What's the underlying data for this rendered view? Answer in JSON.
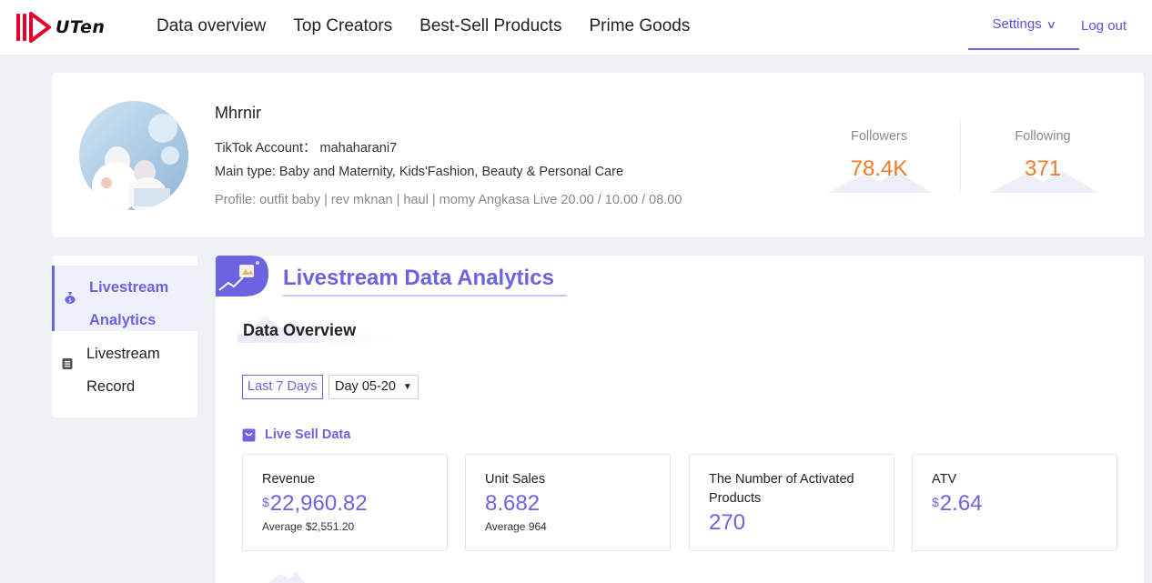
{
  "brand": {
    "name": "UTen",
    "accent": "#6c63e0",
    "highlight": "#f07a28"
  },
  "nav": {
    "items": [
      {
        "label": "Data overview"
      },
      {
        "label": "Top Creators"
      },
      {
        "label": "Best-Sell Products"
      },
      {
        "label": "Prime Goods"
      }
    ],
    "settings_label": "Settings",
    "logout_label": "Log out"
  },
  "profile": {
    "name": "Mhrnir",
    "account": "TikTok Account： mahaharani7",
    "main_type": "Main type:   Baby and Maternity, Kids'Fashion, Beauty & Personal Care",
    "bio": "Profile:  outfit baby | rev mknan | haul | momy Angkasa Live 20.00 / 10.00 / 08.00",
    "followers_label": "Followers",
    "followers_value": "78.4K",
    "following_label": "Following",
    "following_value": "371"
  },
  "sidebar": {
    "items": [
      {
        "label": "Livestream Analytics",
        "icon": "moneybag-icon",
        "active": true
      },
      {
        "label": "Livestream Record",
        "icon": "record-list-icon",
        "active": false
      }
    ]
  },
  "main": {
    "title": "Livestream Data Analytics",
    "overview_title": "Data Overview",
    "range_button": "Last 7 Days",
    "day_select": "Day 05-20",
    "section_title": "Live Sell Data",
    "metrics": [
      {
        "label": "Revenue",
        "currency": "$",
        "value": "22,960.82",
        "avg": "Average $2,551.20"
      },
      {
        "label": "Unit Sales",
        "currency": "",
        "value": "8.682",
        "avg": "Average 964"
      },
      {
        "label": "The Number of Activated Products",
        "currency": "",
        "value": "270",
        "avg": ""
      },
      {
        "label": "ATV",
        "currency": "$",
        "value": "2.64",
        "avg": ""
      }
    ]
  }
}
